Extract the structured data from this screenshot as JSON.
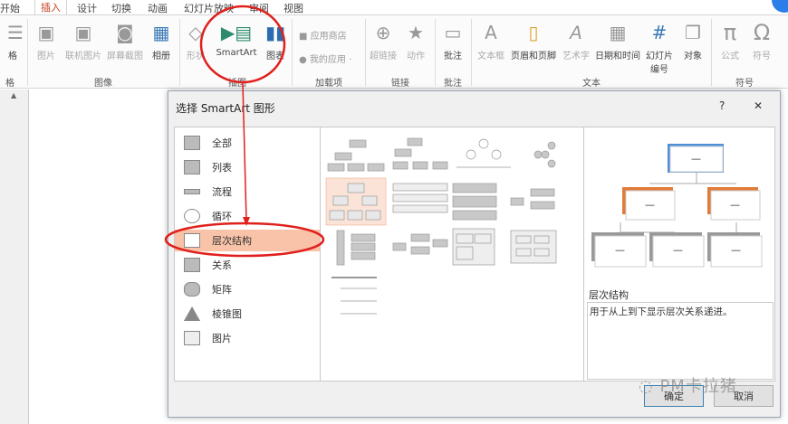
{
  "tabs": [
    "开始",
    "插入",
    "设计",
    "切换",
    "动画",
    "幻灯片放映",
    "审阅",
    "视图"
  ],
  "ribbon": {
    "buttons": {
      "table": "格",
      "picture": "图片",
      "online_picture": "联机图片",
      "screenshot": "屏幕截图",
      "album": "相册",
      "shapes": "形状",
      "smartart": "SmartArt",
      "chart": "图表",
      "store": "应用商店",
      "my_apps": "我的应用",
      "hyperlink": "超链接",
      "action": "动作",
      "comment": "批注",
      "textbox": "文本框",
      "header_footer": "页眉和页脚",
      "wordart": "艺术字",
      "datetime": "日期和时间",
      "slide_number": "幻灯片编号",
      "object": "对象",
      "equation": "公式",
      "symbol": "符号"
    },
    "groups": {
      "table": "格",
      "images": "图像",
      "illustrations": "插图",
      "addins": "加载项",
      "links": "链接",
      "comments": "批注",
      "text": "文本",
      "symbols": "符号"
    }
  },
  "dialog": {
    "title": "选择 SmartArt 图形",
    "help": "?",
    "close": "✕",
    "categories": [
      "全部",
      "列表",
      "流程",
      "循环",
      "层次结构",
      "关系",
      "矩阵",
      "棱锥图",
      "图片"
    ],
    "selected_category": "层次结构",
    "preview_title": "层次结构",
    "preview_desc": "用于从上到下显示层次关系递进。",
    "preview_box_text": "—",
    "ok": "确定",
    "cancel": "取消"
  },
  "watermark": "PM卡拉猪",
  "colors": {
    "accent": "#c43e1c",
    "annotation": "#e0201c",
    "selection": "#f8c3a8",
    "preview_blue": "#4f8fd8",
    "preview_orange": "#e07b39"
  }
}
